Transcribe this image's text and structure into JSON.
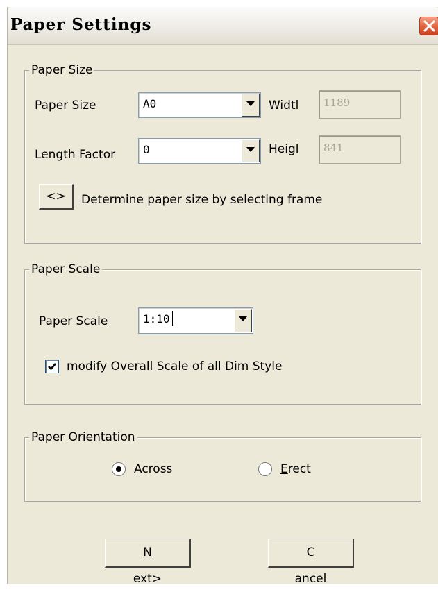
{
  "window": {
    "title": "Paper Settings"
  },
  "paper_size_group": {
    "legend": "Paper Size",
    "paper_size_label": "Paper Size",
    "paper_size_value": "A0",
    "width_label": "Widtl",
    "width_value": "1189",
    "length_factor_label": "Length Factor",
    "length_factor_value": "0",
    "height_label": "Heigl",
    "height_value": "841",
    "frame_button_label": "<>",
    "frame_text": "Determine paper size by selecting frame"
  },
  "paper_scale_group": {
    "legend": "Paper Scale",
    "scale_label": "Paper Scale",
    "scale_value": "1:10",
    "modify_checkbox_checked": true,
    "modify_label": "modify Overall Scale of all Dim Style"
  },
  "orientation_group": {
    "legend": "Paper Orientation",
    "selected": "Across",
    "options": [
      {
        "mnemonic": "",
        "rest": "Across"
      },
      {
        "mnemonic": "E",
        "rest": "rect"
      }
    ]
  },
  "buttons": {
    "next": {
      "mnemonic": "N",
      "rest": "ext>"
    },
    "cancel": {
      "mnemonic": "C",
      "rest": "ancel"
    }
  }
}
